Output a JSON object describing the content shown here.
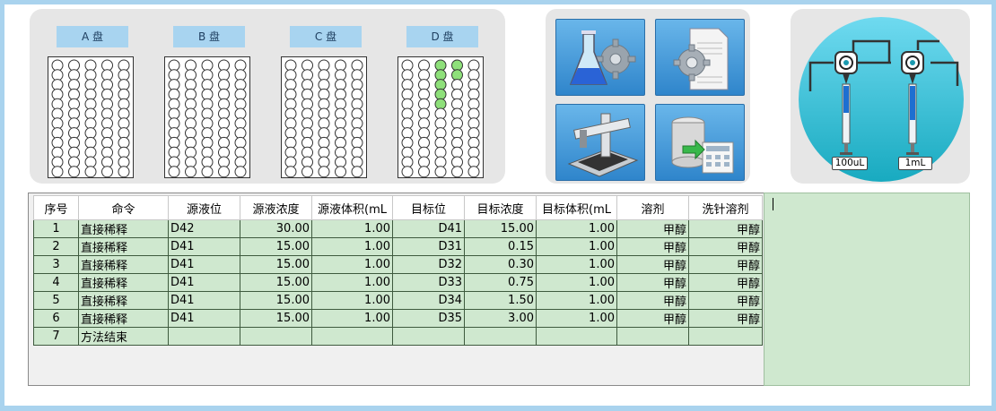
{
  "plates": [
    {
      "label": "A 盘",
      "filled_wells": []
    },
    {
      "label": "B 盘",
      "filled_wells": []
    },
    {
      "label": "C 盘",
      "filled_wells": []
    },
    {
      "label": "D 盘",
      "filled_wells": [
        "D41",
        "D42",
        "D31",
        "D32",
        "D33",
        "D34",
        "D35"
      ]
    }
  ],
  "plate_layout": {
    "columns": 5,
    "rows": 12
  },
  "colors": {
    "well_filled": "#8ee07a",
    "well_empty": "#ffffff",
    "row_bg": "#cfe8cf",
    "plate_label_bg": "#a8d4f0",
    "tool_button_bg": "#3d91d2",
    "page_bg": "#a9d3ee"
  },
  "tools": [
    {
      "name": "method-flask-icon"
    },
    {
      "name": "settings-document-icon"
    },
    {
      "name": "autosampler-robot-icon"
    },
    {
      "name": "database-export-icon"
    }
  ],
  "syringes": [
    {
      "label": "100uL"
    },
    {
      "label": "1mL"
    }
  ],
  "table": {
    "columns": [
      "序号",
      "命令",
      "源液位",
      "源液浓度",
      "源液体积(mL",
      "目标位",
      "目标浓度",
      "目标体积(mL",
      "溶剂",
      "洗针溶剂"
    ],
    "rows": [
      [
        "1",
        "直接稀释",
        "D42",
        "30.00",
        "1.00",
        "D41",
        "15.00",
        "1.00",
        "甲醇",
        "甲醇"
      ],
      [
        "2",
        "直接稀释",
        "D41",
        "15.00",
        "1.00",
        "D31",
        "0.15",
        "1.00",
        "甲醇",
        "甲醇"
      ],
      [
        "3",
        "直接稀释",
        "D41",
        "15.00",
        "1.00",
        "D32",
        "0.30",
        "1.00",
        "甲醇",
        "甲醇"
      ],
      [
        "4",
        "直接稀释",
        "D41",
        "15.00",
        "1.00",
        "D33",
        "0.75",
        "1.00",
        "甲醇",
        "甲醇"
      ],
      [
        "5",
        "直接稀释",
        "D41",
        "15.00",
        "1.00",
        "D34",
        "1.50",
        "1.00",
        "甲醇",
        "甲醇"
      ],
      [
        "6",
        "直接稀释",
        "D41",
        "15.00",
        "1.00",
        "D35",
        "3.00",
        "1.00",
        "甲醇",
        "甲醇"
      ],
      [
        "7",
        "方法结束",
        "",
        "",
        "",
        "",
        "",
        "",
        "",
        ""
      ]
    ]
  }
}
